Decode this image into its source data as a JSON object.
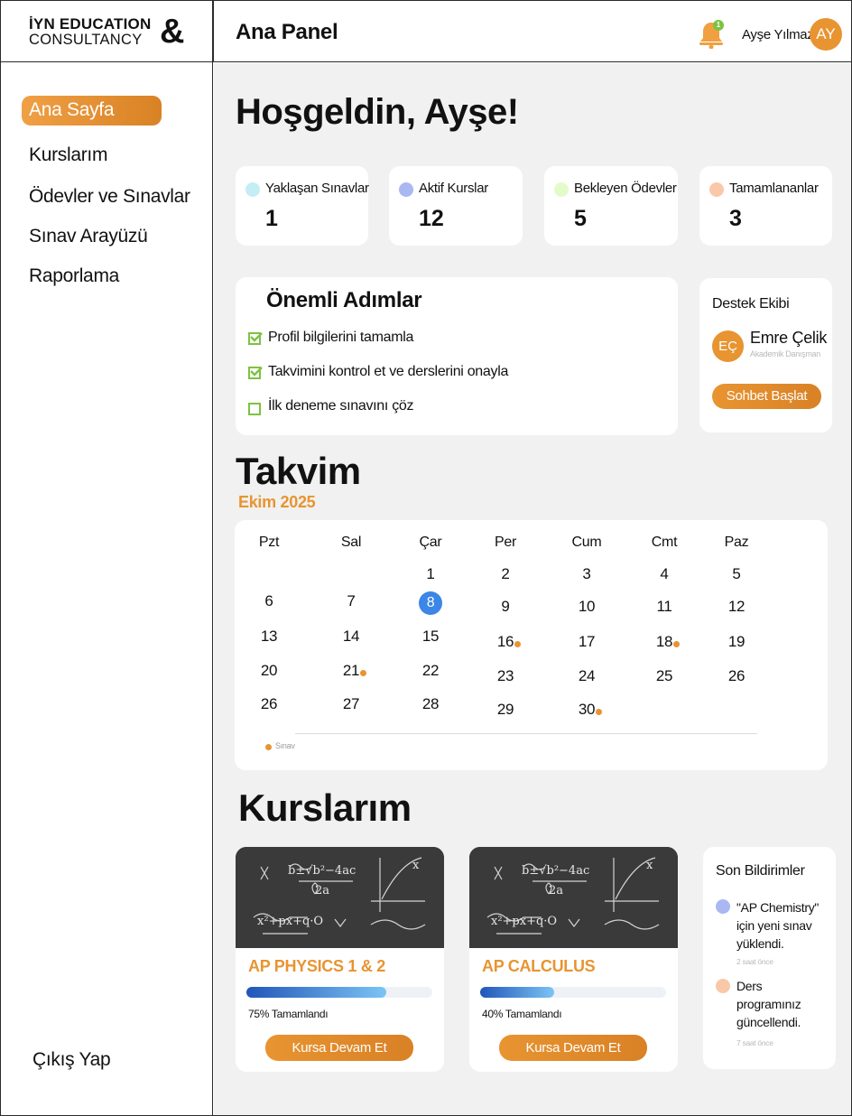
{
  "brand": {
    "line1": "İYN EDUCATION",
    "line2": "CONSULTANCY",
    "amp": "&"
  },
  "header": {
    "title": "Ana Panel",
    "notification_count": "1",
    "user_name": "Ayşe Yılmaz",
    "user_initials": "AY"
  },
  "sidebar": {
    "items": [
      {
        "label": "Ana Sayfa",
        "active": true
      },
      {
        "label": "Kurslarım"
      },
      {
        "label": "Ödevler ve Sınavlar"
      },
      {
        "label": "Sınav Arayüzü"
      },
      {
        "label": "Raporlama"
      }
    ],
    "logout": "Çıkış Yap"
  },
  "welcome": "Hoşgeldin, Ayşe!",
  "stats": [
    {
      "label": "Yaklaşan Sınavlar",
      "value": "1",
      "color": "#c4eef3"
    },
    {
      "label": "Aktif Kurslar",
      "value": "12",
      "color": "#a9b8f2"
    },
    {
      "label": "Bekleyen Ödevler",
      "value": "5",
      "color": "#e3fbc9"
    },
    {
      "label": "Tamamlananlar",
      "value": "3",
      "color": "#f8c8a8"
    }
  ],
  "steps": {
    "title": "Önemli Adımlar",
    "items": [
      {
        "label": "Profil bilgilerini tamamla",
        "done": true
      },
      {
        "label": "Takvimini kontrol et ve derslerini onayla",
        "done": true
      },
      {
        "label": "İlk deneme sınavını çöz",
        "done": false
      }
    ]
  },
  "support": {
    "title": "Destek Ekibi",
    "initials": "EÇ",
    "name": "Emre Çelik",
    "role": "Akademik Danışman",
    "button": "Sohbet Başlat"
  },
  "calendar": {
    "title": "Takvim",
    "month": "Ekim 2025",
    "weekdays": [
      "Pzt",
      "Sal",
      "Çar",
      "Per",
      "Cum",
      "Cmt",
      "Paz"
    ],
    "weeks": [
      [
        "",
        "",
        "1",
        "2",
        "3",
        "4",
        "5"
      ],
      [
        "6",
        "7",
        "8",
        "9",
        "10",
        "11",
        "12"
      ],
      [
        "13",
        "14",
        "15",
        "16",
        "17",
        "18",
        "19"
      ],
      [
        "20",
        "21",
        "22",
        "23",
        "24",
        "25",
        "26"
      ],
      [
        "26",
        "27",
        "28",
        "29",
        "30",
        "",
        ""
      ]
    ],
    "today": "8",
    "exam_days": [
      "16",
      "18",
      "21",
      "30"
    ],
    "legend": "Sınav"
  },
  "courses": {
    "title": "Kurslarım",
    "items": [
      {
        "name": "AP PHYSICS 1 & 2",
        "progress": 0.75,
        "progress_label": "75% Tamamlandı",
        "button": "Kursa Devam Et"
      },
      {
        "name": "AP CALCULUS",
        "progress": 0.4,
        "progress_label": "40% Tamamlandı",
        "button": "Kursa Devam Et"
      }
    ]
  },
  "notifications": {
    "title": "Son Bildirimler",
    "items": [
      {
        "text": "\"AP Chemistry\" için yeni sınav yüklendi.",
        "time": "2 saat önce",
        "color": "#a9b8f2"
      },
      {
        "text": "Ders programınız güncellendi.",
        "time": "7 saat önce",
        "color": "#f8c8a8"
      }
    ]
  }
}
